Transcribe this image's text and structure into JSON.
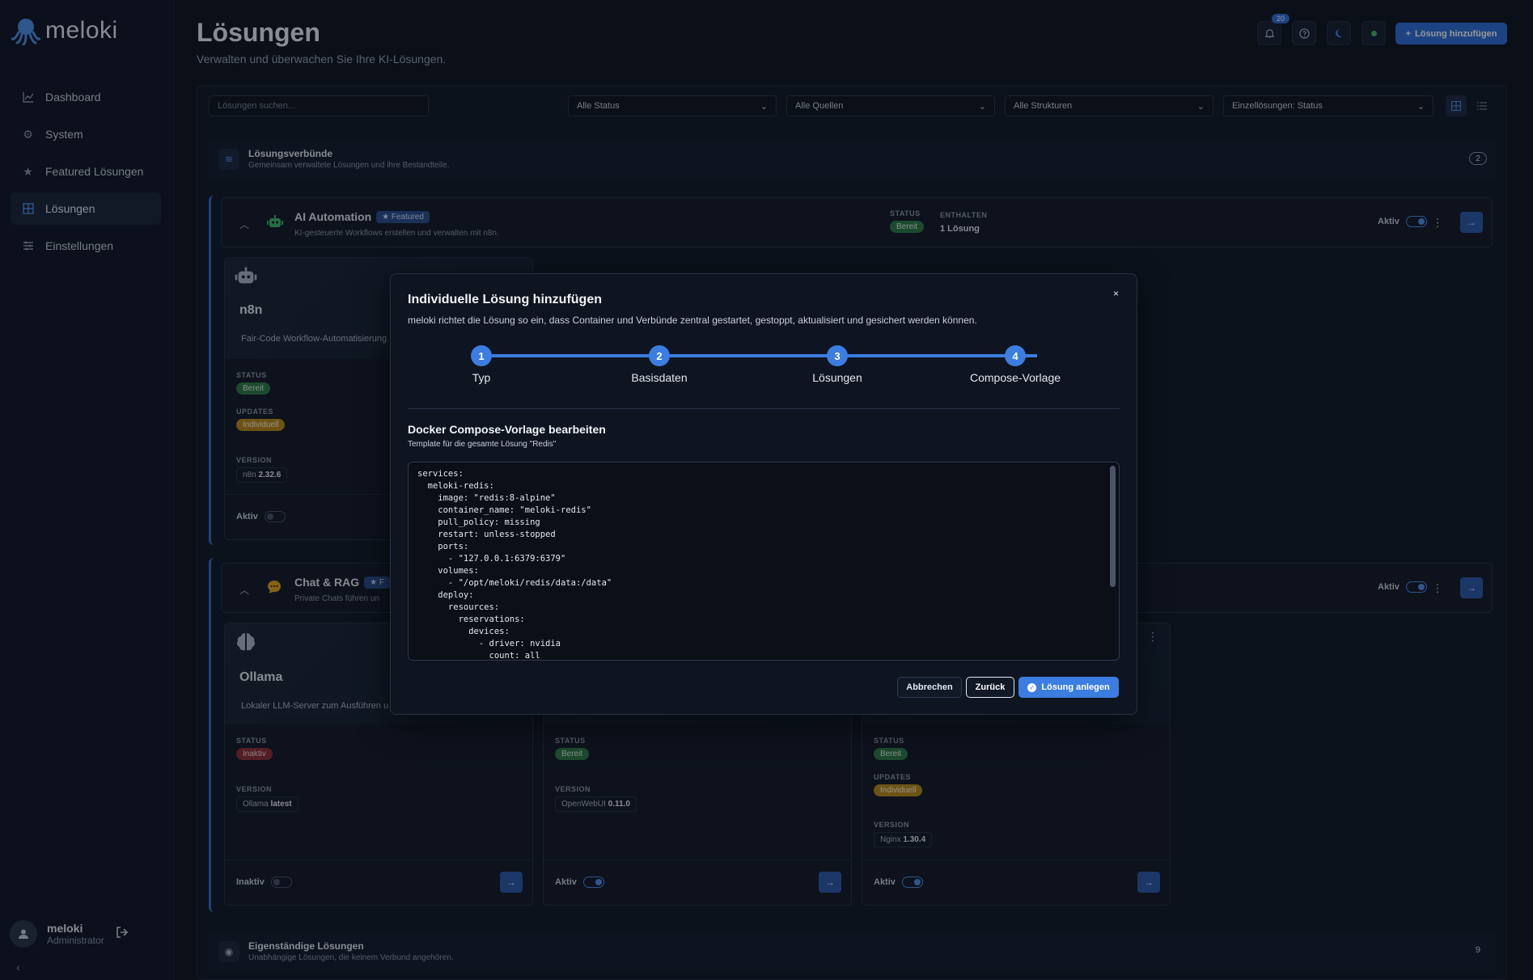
{
  "app": {
    "name": "meloki"
  },
  "sidebar": {
    "items": [
      {
        "label": "Dashboard",
        "icon": "chart-line-icon"
      },
      {
        "label": "System",
        "icon": "gear-icon"
      },
      {
        "label": "Featured Lösungen",
        "icon": "star-icon"
      },
      {
        "label": "Lösungen",
        "icon": "grid-icon",
        "active": true
      },
      {
        "label": "Einstellungen",
        "icon": "sliders-icon"
      }
    ],
    "user": {
      "name": "meloki",
      "role": "Administrator"
    }
  },
  "header": {
    "title": "Lösungen",
    "subtitle": "Verwalten und überwachen Sie Ihre KI-Lösungen.",
    "notification_count": "20",
    "add_button": "Lösung hinzufügen"
  },
  "filters": {
    "search_placeholder": "Lösungen suchen...",
    "status": "Alle Status",
    "sources": "Alle Quellen",
    "structures": "Alle Strukturen",
    "single": "Einzellösungen: Status"
  },
  "groups": {
    "clusters": {
      "title": "Lösungsverbünde",
      "subtitle": "Gemeinsam verwaltete Lösungen und ihre Bestandteile.",
      "count": "2"
    },
    "standalone": {
      "title": "Eigenständige Lösungen",
      "subtitle": "Unabhängige Lösungen, die keinem Verbund angehören.",
      "count": "9"
    }
  },
  "clusters": [
    {
      "title": "AI Automation",
      "featured": "Featured",
      "subtitle": "KI-gesteuerte Workflows erstellen und verwalten mit n8n.",
      "status_label": "STATUS",
      "status": "Bereit",
      "contains_label": "ENTHALTEN",
      "contains": "1 Lösung",
      "active_label": "Aktiv"
    },
    {
      "title": "Chat & RAG",
      "featured": "F",
      "subtitle": "Private Chats führen un",
      "active_label": "Aktiv"
    }
  ],
  "cards": {
    "n8n": {
      "name": "n8n",
      "desc": "Fair-Code Workflow-Automatisierung",
      "status_label": "STATUS",
      "status": "Bereit",
      "updates_label": "UPDATES",
      "updates": "Individuell",
      "version_label": "VERSION",
      "version_name": "n8n",
      "version": "2.32.6",
      "foot": "Aktiv"
    },
    "ollama": {
      "name": "Ollama",
      "desc": "Lokaler LLM-Server zum Ausführen u",
      "status_label": "STATUS",
      "status": "Inaktiv",
      "version_label": "VERSION",
      "version_name": "Ollama",
      "version": "latest",
      "foot": "Inaktiv"
    },
    "openwebui": {
      "status_label": "STATUS",
      "status": "Bereit",
      "version_label": "VERSION",
      "version_name": "OpenWebUI",
      "version": "0.11.0",
      "foot": "Aktiv"
    },
    "nginx": {
      "status_label": "STATUS",
      "status": "Bereit",
      "updates_label": "UPDATES",
      "updates": "Individuell",
      "version_label": "VERSION",
      "version_name": "Nginx",
      "version": "1.30.4",
      "foot": "Aktiv"
    }
  },
  "modal": {
    "title": "Individuelle Lösung hinzufügen",
    "subtitle": "meloki richtet die Lösung so ein, dass Container und Verbünde zentral gestartet, gestoppt, aktualisiert und gesichert werden können.",
    "close": "×",
    "steps": [
      {
        "num": "1",
        "label": "Typ"
      },
      {
        "num": "2",
        "label": "Basisdaten"
      },
      {
        "num": "3",
        "label": "Lösungen"
      },
      {
        "num": "4",
        "label": "Compose-Vorlage"
      }
    ],
    "section_title": "Docker Compose-Vorlage bearbeiten",
    "section_subtitle": "Template für die gesamte Lösung \"Redis\"",
    "compose": "services:\n  meloki-redis:\n    image: \"redis:8-alpine\"\n    container_name: \"meloki-redis\"\n    pull_policy: missing\n    restart: unless-stopped\n    ports:\n      - \"127.0.0.1:6379:6379\"\n    volumes:\n      - \"/opt/meloki/redis/data:/data\"\n    deploy:\n      resources:\n        reservations:\n          devices:\n            - driver: nvidia\n              count: all",
    "cancel": "Abbrechen",
    "back": "Zurück",
    "create": "Lösung anlegen"
  },
  "colors": {
    "accent": "#3b7de0",
    "bg": "#0f1520",
    "green": "#2f7a46",
    "yellow": "#b88a1b",
    "red": "#8c2f36"
  }
}
